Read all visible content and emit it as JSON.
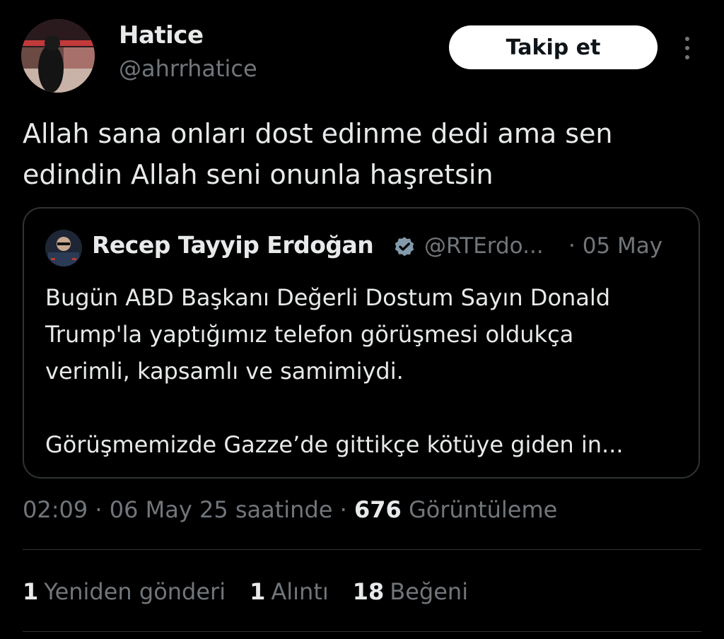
{
  "author": {
    "name": "Hatice",
    "handle": "@ahrrhatice"
  },
  "follow_button": {
    "label": "Takip et"
  },
  "tweet": {
    "text_line1": "Allah sana onları dost edinme dedi ama sen",
    "text_line2": "edindin Allah seni onunla haşretsin"
  },
  "quoted_tweet": {
    "name": "Recep Tayyip Erdoğan",
    "handle": "@RTErdo...",
    "date": "· 05 May",
    "line1": "Bugün ABD Başkanı Değerli Dostum Sayın Donald",
    "line2": "Trump'la yaptığımız telefon görüşmesi oldukça",
    "line3": "verimli, kapsamlı ve samimiydi.",
    "line4": "Görüşmemizde Gazze’de gittikçe kötüye giden in..."
  },
  "meta": {
    "time": "02:09",
    "sep1": "·",
    "date": "06 May 25 saatinde",
    "sep2": "·",
    "views_count": "676",
    "views_label": "Görüntüleme"
  },
  "stats": {
    "reposts_count": "1",
    "reposts_label": "Yeniden gönderi",
    "quotes_count": "1",
    "quotes_label": "Alıntı",
    "likes_count": "18",
    "likes_label": "Beğeni"
  },
  "colors": {
    "background": "#000000",
    "text": "#e7e9ea",
    "secondary": "#71767b",
    "border": "#2f3336",
    "verified": "#829aab"
  },
  "icons": [
    "avatar-photo",
    "more-icon",
    "verified-badge-icon"
  ]
}
